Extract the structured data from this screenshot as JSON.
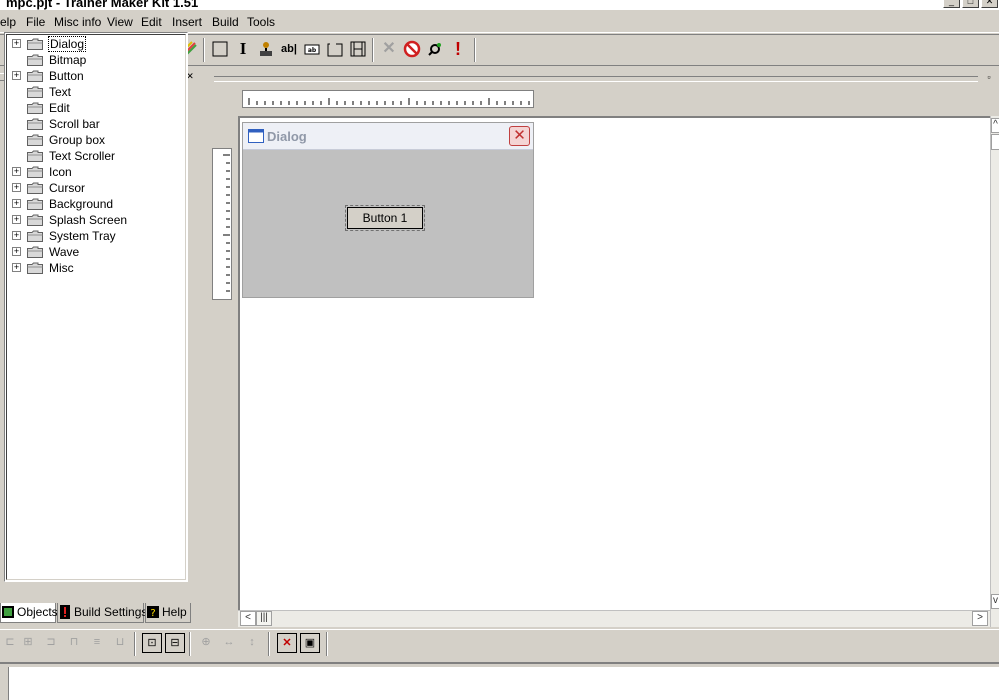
{
  "window": {
    "title": "mpc.pjt - Trainer Maker Kit 1.51"
  },
  "menu": {
    "items": [
      "elp",
      "File",
      "Misc info",
      "View",
      "Edit",
      "Insert",
      "Build",
      "Tools"
    ]
  },
  "toolbar": {
    "icons": [
      "help-icon",
      "save-icon",
      "bar-chart-icon",
      "grid-icon",
      "layout-icon",
      "zoom-icon",
      "pattern-icon",
      "preview-icon",
      "color-icon",
      "frame-icon",
      "text-cursor-icon",
      "tool-icon",
      "edit-box-icon",
      "button-control-icon",
      "group-box-icon",
      "film-icon",
      "delete-icon",
      "no-entry-icon",
      "settings-icon",
      "alert-icon"
    ],
    "text_glyphs": {
      "edit_box": "ab|",
      "button_ctrl": "ab"
    }
  },
  "tree": {
    "items": [
      {
        "label": "Dialog",
        "expandable": true,
        "selected": true
      },
      {
        "label": "Bitmap",
        "expandable": false
      },
      {
        "label": "Button",
        "expandable": true
      },
      {
        "label": "Text",
        "expandable": false
      },
      {
        "label": "Edit",
        "expandable": false
      },
      {
        "label": "Scroll bar",
        "expandable": false
      },
      {
        "label": "Group box",
        "expandable": false
      },
      {
        "label": "Text Scroller",
        "expandable": false
      },
      {
        "label": "Icon",
        "expandable": true
      },
      {
        "label": "Cursor",
        "expandable": true
      },
      {
        "label": "Background",
        "expandable": true
      },
      {
        "label": "Splash Screen",
        "expandable": true
      },
      {
        "label": "System Tray",
        "expandable": true
      },
      {
        "label": "Wave",
        "expandable": true
      },
      {
        "label": "Misc",
        "expandable": true
      }
    ],
    "expander_symbol": "+"
  },
  "tabs": {
    "objects": "Objects",
    "build_settings": "Build Settings",
    "help": "Help"
  },
  "dialog": {
    "title": "Dialog",
    "close_glyph": "✕",
    "button_label": "Button 1"
  },
  "colors": {
    "chrome": "#d4d0c8",
    "canvas": "#ffffff",
    "dialog_body": "#c0c0c0",
    "close_red": "#c03030"
  }
}
